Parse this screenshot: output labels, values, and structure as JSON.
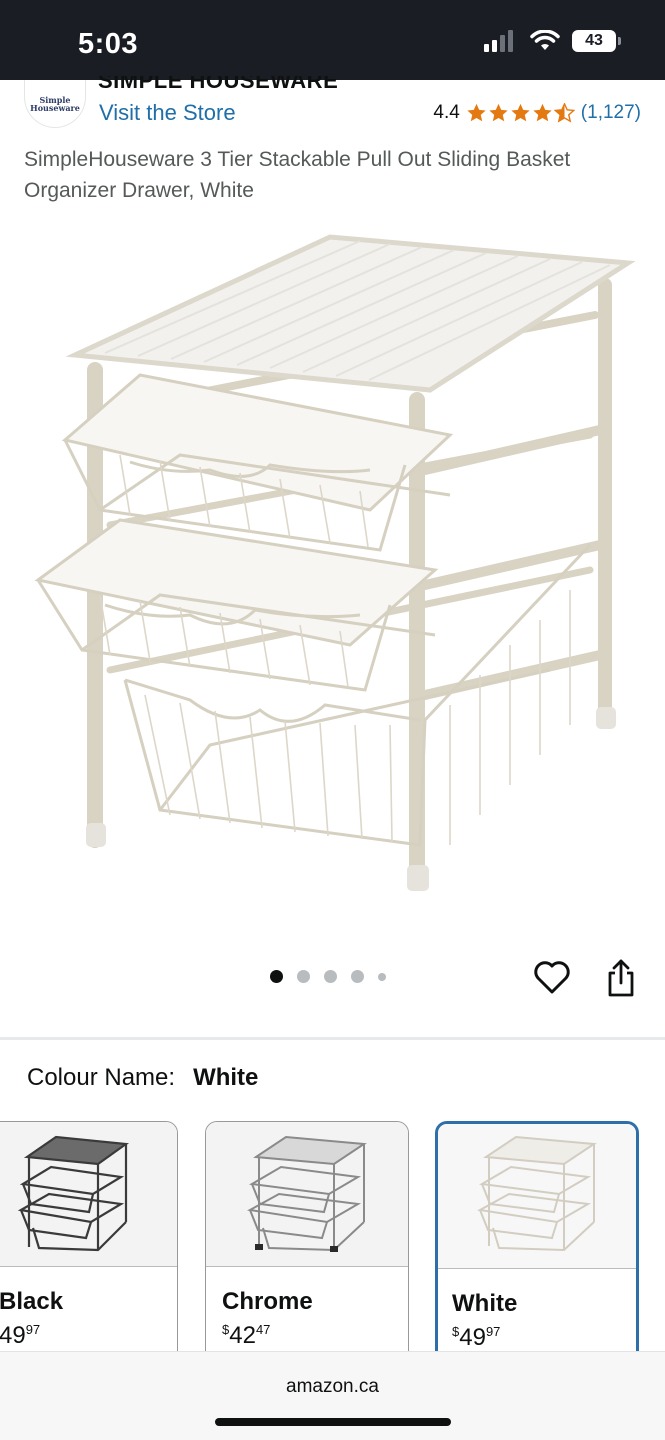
{
  "status_bar": {
    "time": "5:03",
    "battery": "43",
    "icons": [
      "signal-icon",
      "wifi-icon",
      "battery-icon"
    ]
  },
  "header": {
    "brand": "SIMPLE HOUSEWARE",
    "logo_text_1": "Simple",
    "logo_text_2": "Houseware",
    "visit_store": "Visit the Store",
    "rating": "4.4",
    "rating_stars": 4.4,
    "rating_count": "(1,127)"
  },
  "product": {
    "title": "SimpleHouseware 3 Tier Stackable Pull Out Sliding Basket Organizer Drawer, White",
    "image_count": 5,
    "active_image": 1
  },
  "colour": {
    "label": "Colour Name:",
    "selected": "White",
    "options": [
      {
        "name": "Black",
        "price_main": "49",
        "price_cents": "97"
      },
      {
        "name": "Chrome",
        "price_symbol": "$",
        "price_main": "42",
        "price_cents": "47"
      },
      {
        "name": "White",
        "price_symbol": "$",
        "price_main": "49",
        "price_cents": "97"
      }
    ]
  },
  "footer": {
    "domain": "amazon.ca"
  },
  "colors": {
    "link": "#1f6fa8",
    "star": "#e47911",
    "selected_border": "#2f6fa9"
  }
}
